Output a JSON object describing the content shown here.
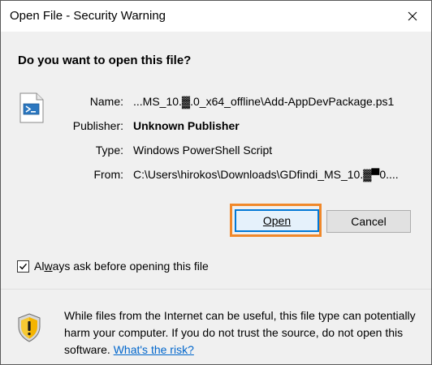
{
  "window": {
    "title": "Open File - Security Warning"
  },
  "dialog": {
    "question": "Do you want to open this file?",
    "details": [
      {
        "label": "Name:",
        "value": "...MS_10.▓.0_x64_offline\\Add-AppDevPackage.ps1",
        "bold": false
      },
      {
        "label": "Publisher:",
        "value": "Unknown Publisher",
        "bold": true
      },
      {
        "label": "Type:",
        "value": "Windows PowerShell Script",
        "bold": false
      },
      {
        "label": "From:",
        "value": "C:\\Users\\hirokos\\Downloads\\GDfindi_MS_10.▓▀0....",
        "bold": false
      }
    ],
    "file_icon": "powershell-script-icon"
  },
  "buttons": {
    "open_label": "Open",
    "cancel_label": "Cancel"
  },
  "checkbox": {
    "label_prefix": "Al",
    "label_mnemonic": "w",
    "label_suffix": "ays ask before opening this file",
    "checked": true
  },
  "footer": {
    "icon": "shield-warning-icon",
    "warning_text": "While files from the Internet can be useful, this file type can potentially harm your computer. If you do not trust the source, do not open this software.",
    "link_text": "What's the risk?"
  },
  "colors": {
    "accent": "#0078d7",
    "highlight": "#f0882a",
    "link": "#0066cc"
  }
}
